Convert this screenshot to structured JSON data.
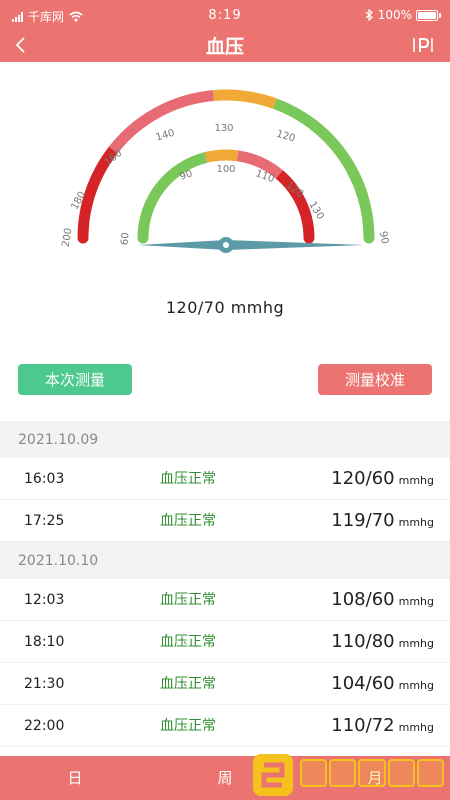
{
  "status_bar": {
    "carrier": "千库网",
    "time": "8:19",
    "battery": "100%"
  },
  "nav": {
    "title": "血压"
  },
  "gauge": {
    "outer_labels": [
      "200",
      "180",
      "160",
      "140",
      "130",
      "120",
      "90"
    ],
    "inner_labels": [
      "60",
      "90",
      "100",
      "110",
      "120",
      "130"
    ],
    "colors": {
      "red": "#d42427",
      "pink": "#e86a72",
      "orange": "#f0a936",
      "green": "#7ac85a",
      "needle": "#5b9aa6"
    }
  },
  "reading": "120/70 mmhg",
  "buttons": {
    "measure": "本次测量",
    "calibrate": "测量校准"
  },
  "groups": [
    {
      "date": "2021.10.09",
      "rows": [
        {
          "time": "16:03",
          "status": "血压正常",
          "value": "120/60",
          "unit": "mmhg"
        },
        {
          "time": "17:25",
          "status": "血压正常",
          "value": "119/70",
          "unit": "mmhg"
        }
      ]
    },
    {
      "date": "2021.10.10",
      "rows": [
        {
          "time": "12:03",
          "status": "血压正常",
          "value": "108/60",
          "unit": "mmhg"
        },
        {
          "time": "18:10",
          "status": "血压正常",
          "value": "110/80",
          "unit": "mmhg"
        },
        {
          "time": "21:30",
          "status": "血压正常",
          "value": "104/60",
          "unit": "mmhg"
        },
        {
          "time": "22:00",
          "status": "血压正常",
          "value": "110/72",
          "unit": "mmhg"
        }
      ]
    }
  ],
  "tabs": {
    "day": "日",
    "week": "周",
    "month": "月"
  }
}
